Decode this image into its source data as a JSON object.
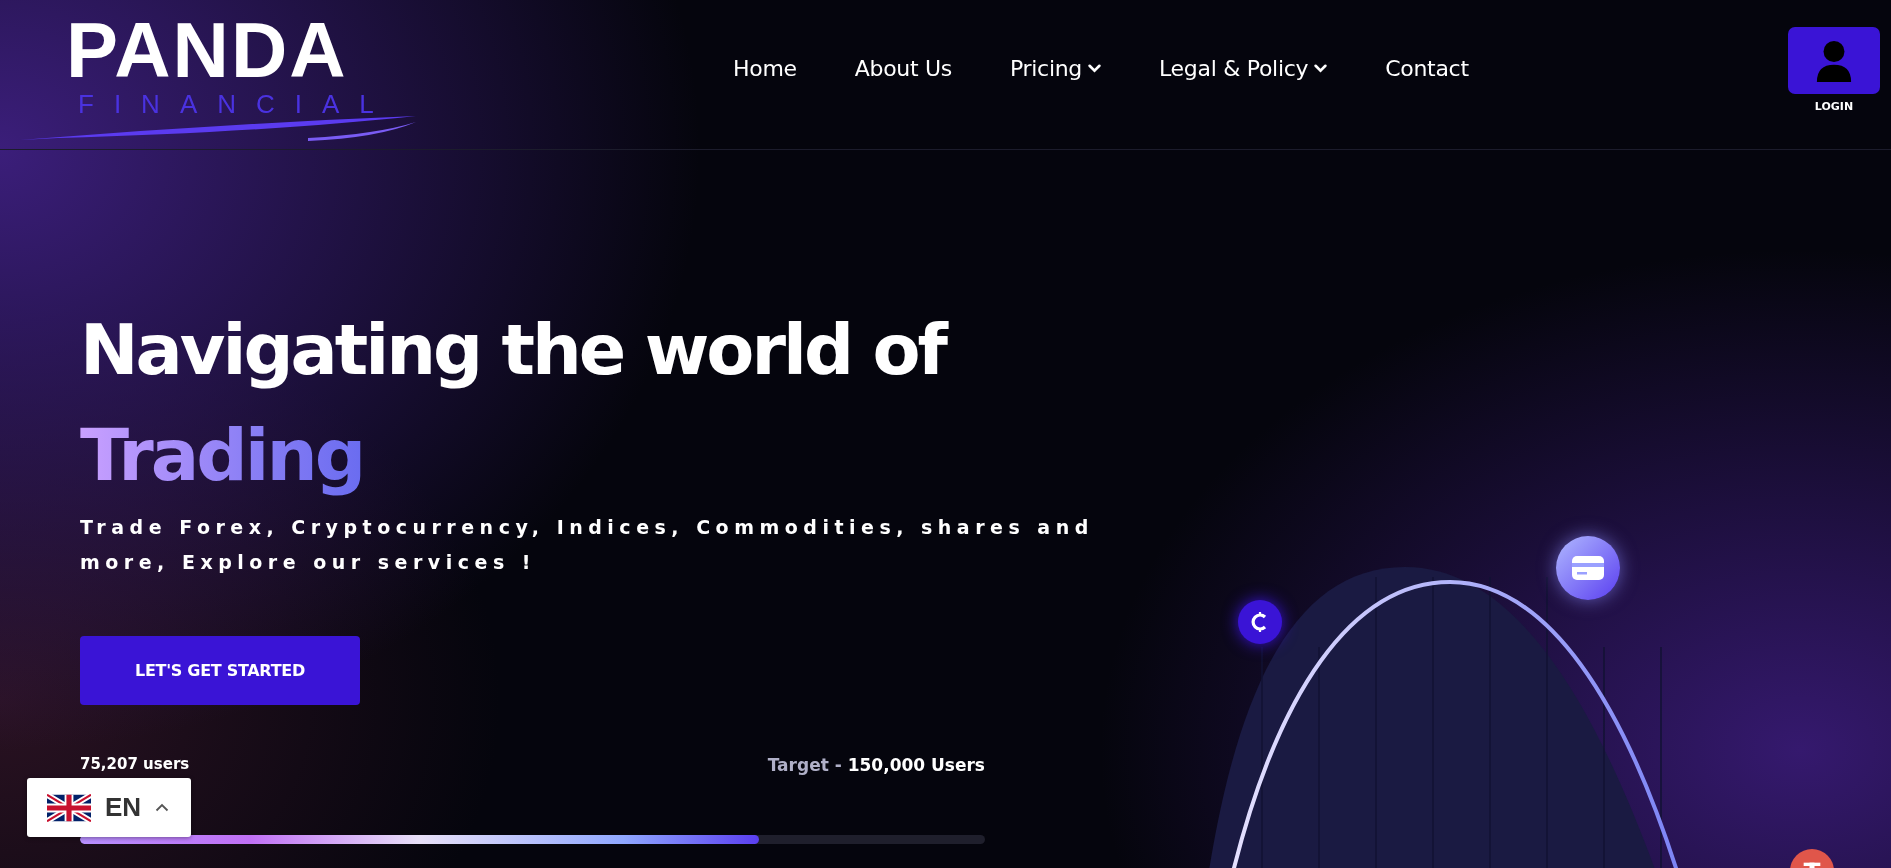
{
  "header": {
    "logo": {
      "title": "PANDA",
      "subtitle": "FINANCIAL"
    },
    "nav": [
      {
        "label": "Home",
        "dropdown": false
      },
      {
        "label": "About Us",
        "dropdown": false
      },
      {
        "label": "Pricing",
        "dropdown": true
      },
      {
        "label": "Legal & Policy",
        "dropdown": true
      },
      {
        "label": "Contact",
        "dropdown": false
      }
    ],
    "login": {
      "label": "LOGIN"
    }
  },
  "hero": {
    "headline": "Navigating the world of",
    "highlight": "Trading",
    "subtitle": "Trade Forex, Cryptocurrency, Indices, Commodities, shares and more, Explore our services !",
    "cta": "LET'S GET STARTED",
    "progress": {
      "current": "75,207 users",
      "target_label": "Target -",
      "target_value": "150,000 Users",
      "level": 0.75
    }
  },
  "language": {
    "code": "EN"
  }
}
